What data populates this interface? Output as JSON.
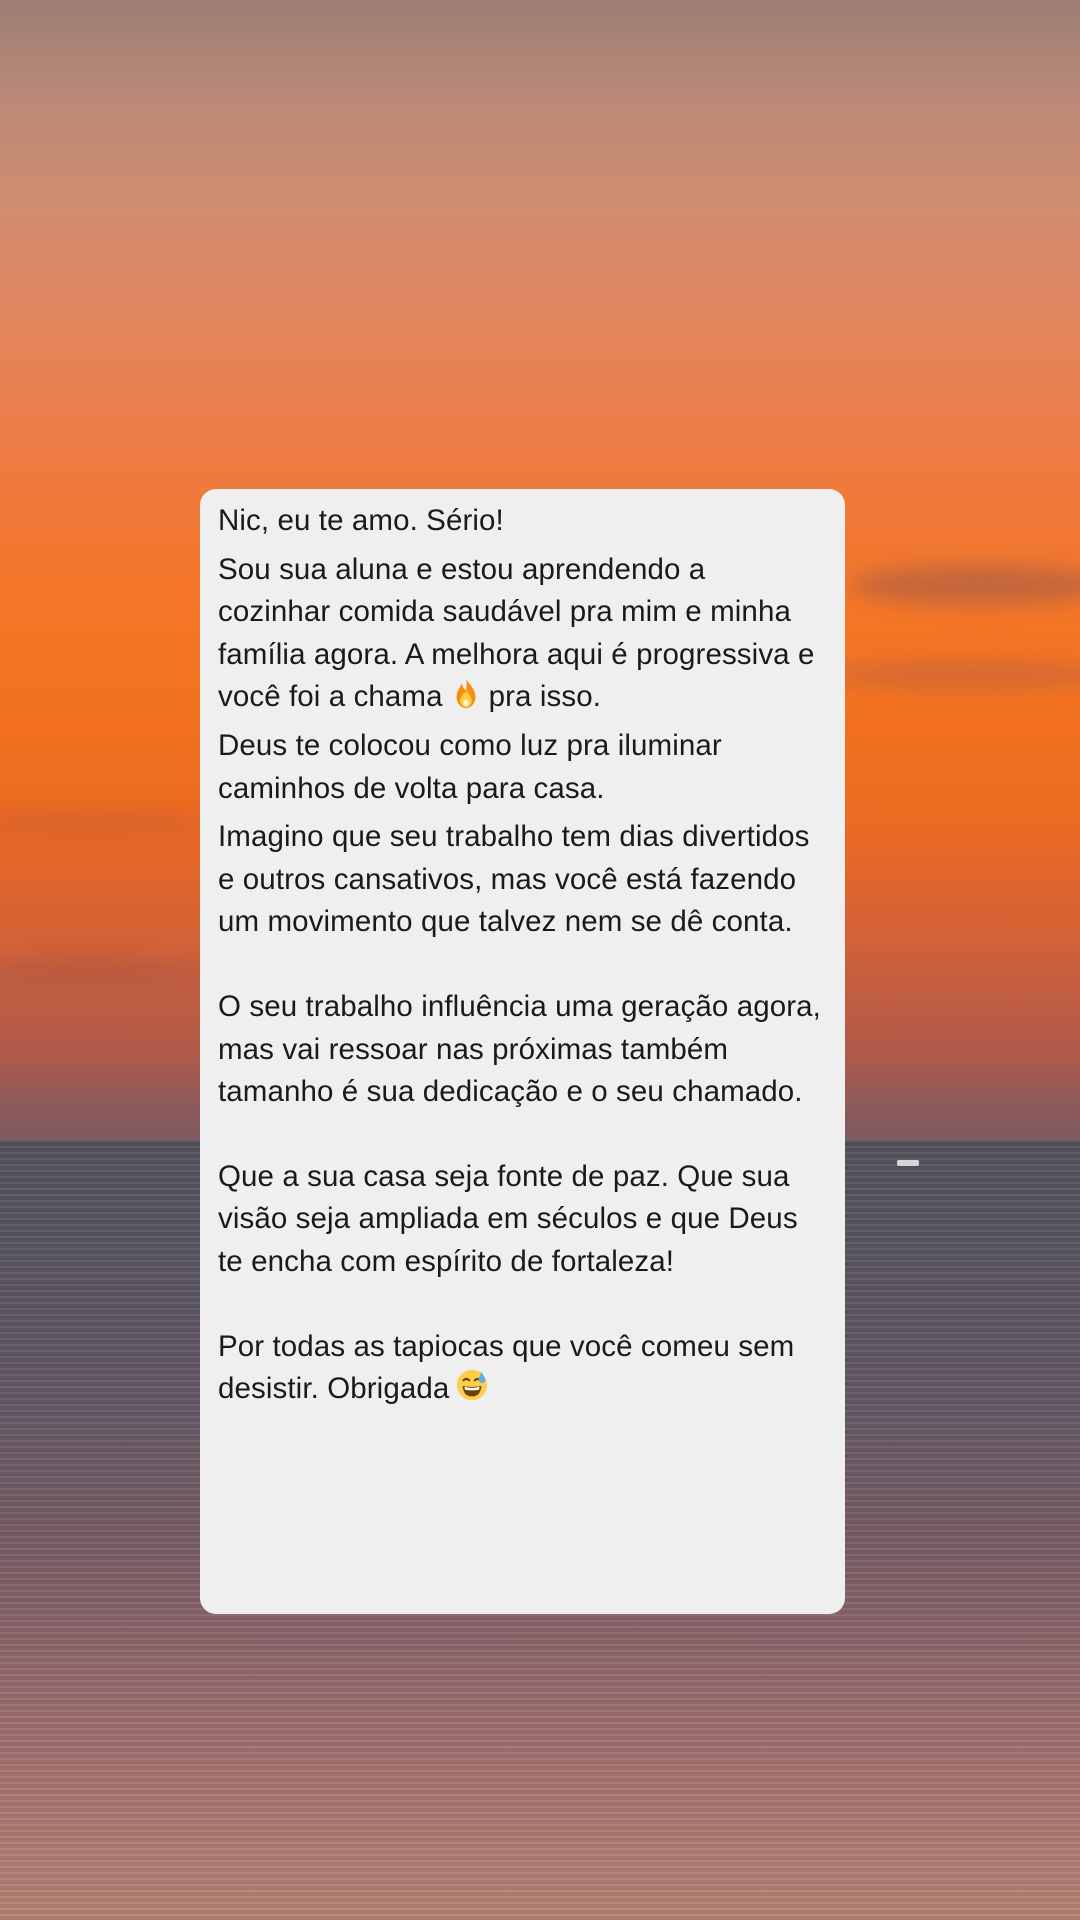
{
  "message": {
    "line1": "Nic, eu te amo. Sério!",
    "line2a": "Sou sua aluna e estou aprendendo a cozinhar comida saudável pra mim e minha família agora. A melhora aqui é progressiva e você foi a chama",
    "line2b": "pra isso.",
    "line3": "Deus te colocou como luz pra iluminar caminhos de volta para casa.",
    "line4": "Imagino que seu trabalho tem dias divertidos e outros cansativos, mas você está fazendo um movimento que talvez nem se dê conta.",
    "line5": "O seu trabalho influência uma geração agora, mas vai ressoar nas próximas também tamanho é sua dedicação e o seu chamado.",
    "line6": "Que a sua casa seja fonte de paz. Que sua visão seja ampliada em séculos e que Deus te encha com espírito de fortaleza!",
    "line7": "Por todas as tapiocas que você comeu sem desistir. Obrigada"
  },
  "icons": {
    "fire": "fire-emoji-icon",
    "smile": "grinning-sweat-emoji-icon"
  }
}
